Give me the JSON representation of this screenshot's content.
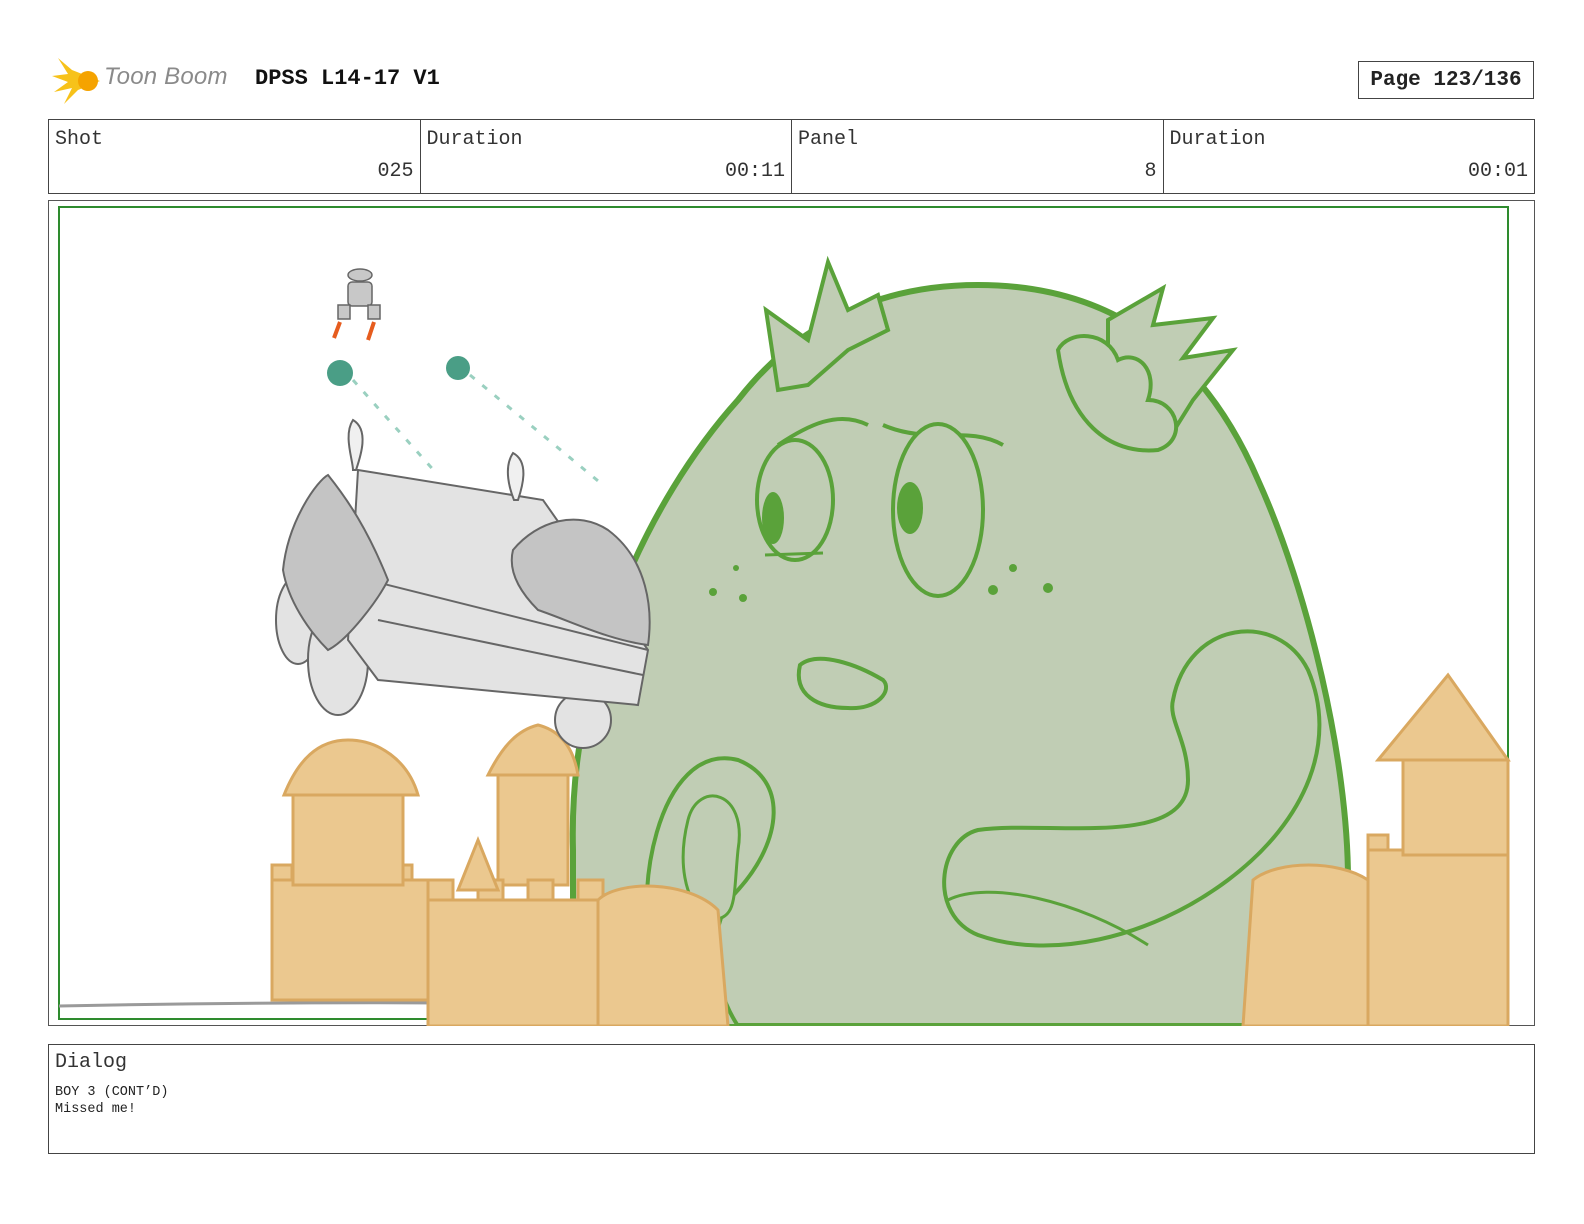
{
  "header": {
    "brand": "Toon Boom",
    "title": "DPSS L14-17 V1",
    "page": "Page 123/136"
  },
  "info": {
    "shot_label": "Shot",
    "shot_value": "025",
    "duration1_label": "Duration",
    "duration1_value": "00:11",
    "panel_label": "Panel",
    "panel_value": "8",
    "duration2_label": "Duration",
    "duration2_value": "00:01"
  },
  "dialog": {
    "label": "Dialog",
    "speaker": "BOY 3 (CONT’D)",
    "line": "Missed me!"
  },
  "colors": {
    "monster_fill": "#c0cdb4",
    "monster_line": "#5aa23a",
    "sand": "#ebc88f",
    "sand_line": "#d9a860",
    "frame_green": "#2e8b2e",
    "car_gray": "#e3e3e3"
  }
}
